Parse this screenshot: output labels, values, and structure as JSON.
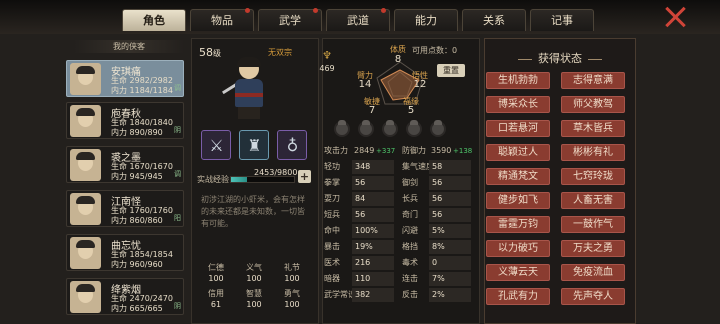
{
  "tabs": [
    {
      "label": "角色",
      "active": true,
      "badge": false
    },
    {
      "label": "物品",
      "active": false,
      "badge": true
    },
    {
      "label": "武学",
      "active": false,
      "badge": true
    },
    {
      "label": "武道",
      "active": false,
      "badge": true
    },
    {
      "label": "能力",
      "active": false,
      "badge": false
    },
    {
      "label": "关系",
      "active": false,
      "badge": false
    },
    {
      "label": "记事",
      "active": false,
      "badge": false
    }
  ],
  "party": {
    "title": "我的侠客",
    "members": [
      {
        "name": "安琪痛",
        "hp": "生命 2982/2982",
        "mp": "内力 1184/1184",
        "status": "调",
        "selected": true
      },
      {
        "name": "庖春秋",
        "hp": "生命 1840/1840",
        "mp": "内力 890/890",
        "status": "阴",
        "selected": false
      },
      {
        "name": "裘之墨",
        "hp": "生命 1670/1670",
        "mp": "内力 945/945",
        "status": "调",
        "selected": false
      },
      {
        "name": "江南怪",
        "hp": "生命 1760/1760",
        "mp": "内力 860/860",
        "status": "阳",
        "selected": false
      },
      {
        "name": "曲忘忧",
        "hp": "生命 1854/1854",
        "mp": "内力 960/960",
        "status": "",
        "selected": false
      },
      {
        "name": "绛紫烟",
        "hp": "生命 2470/2470",
        "mp": "内力 665/665",
        "status": "阴",
        "selected": false
      }
    ]
  },
  "profile": {
    "level": "58",
    "level_unit": "级",
    "sect": "无双宗",
    "exp_label": "实战经验",
    "exp_value": "2453/9800",
    "exp_progress": 0.25,
    "exp_plus": "+",
    "bio": "初涉江湖的小虾米，会有怎样的未来还都是未知数，一切皆有可能。",
    "equipment": [
      "sword-icon",
      "armor-icon",
      "gourd-icon"
    ],
    "traits": [
      {
        "label": "仁德",
        "value": "100"
      },
      {
        "label": "义气",
        "value": "100"
      },
      {
        "label": "礼节",
        "value": "100"
      },
      {
        "label": "信用",
        "value": "61"
      },
      {
        "label": "智慧",
        "value": "100"
      },
      {
        "label": "勇气",
        "value": "100"
      }
    ]
  },
  "attributes": {
    "points_value": "469",
    "available_label": "可用点数：",
    "available_value": "0",
    "reset_label": "重置",
    "radar": [
      {
        "label": "体质",
        "value": "8"
      },
      {
        "label": "悟性",
        "value": "12"
      },
      {
        "label": "福缘",
        "value": "5"
      },
      {
        "label": "敏捷",
        "value": "7"
      },
      {
        "label": "臂力",
        "value": "14"
      }
    ],
    "attack": {
      "label": "攻击力",
      "value": "2849",
      "bonus": "+337"
    },
    "defense": {
      "label": "防御力",
      "value": "3590",
      "bonus": "+138"
    },
    "stats_left": [
      {
        "label": "轻功",
        "value": "348"
      },
      {
        "label": "拳掌",
        "value": "56"
      },
      {
        "label": "耍刀",
        "value": "84"
      },
      {
        "label": "短兵",
        "value": "56"
      },
      {
        "label": "命中",
        "value": "100%"
      },
      {
        "label": "暴击",
        "value": "19%"
      },
      {
        "label": "医术",
        "value": "216"
      },
      {
        "label": "暗器",
        "value": "110"
      },
      {
        "label": "武学常识",
        "value": "382"
      }
    ],
    "stats_right": [
      {
        "label": "集气速度",
        "value": "58"
      },
      {
        "label": "御剑",
        "value": "56"
      },
      {
        "label": "长兵",
        "value": "56"
      },
      {
        "label": "奇门",
        "value": "56"
      },
      {
        "label": "闪避",
        "value": "5%"
      },
      {
        "label": "格挡",
        "value": "8%"
      },
      {
        "label": "毒术",
        "value": "0"
      },
      {
        "label": "连击",
        "value": "7%"
      },
      {
        "label": "反击",
        "value": "2%"
      }
    ]
  },
  "status_panel": {
    "title": "获得状态",
    "items": [
      "生机勃勃",
      "志得意满",
      "博采众长",
      "师父教驾",
      "口若悬河",
      "草木皆兵",
      "聪颖过人",
      "彬彬有礼",
      "精通梵文",
      "七窍玲珑",
      "健步如飞",
      "人畜无害",
      "雷霆万钧",
      "一鼓作气",
      "以力破巧",
      "万夫之勇",
      "义薄云天",
      "免疫流血",
      "孔武有力",
      "先声夺人"
    ]
  },
  "colors": {
    "accent_gold": "#d3a647",
    "status_button": "#8a3c30",
    "exp_bar": "#4ec3b8",
    "bonus_green": "#4ec46a",
    "close_red": "#d04438"
  }
}
